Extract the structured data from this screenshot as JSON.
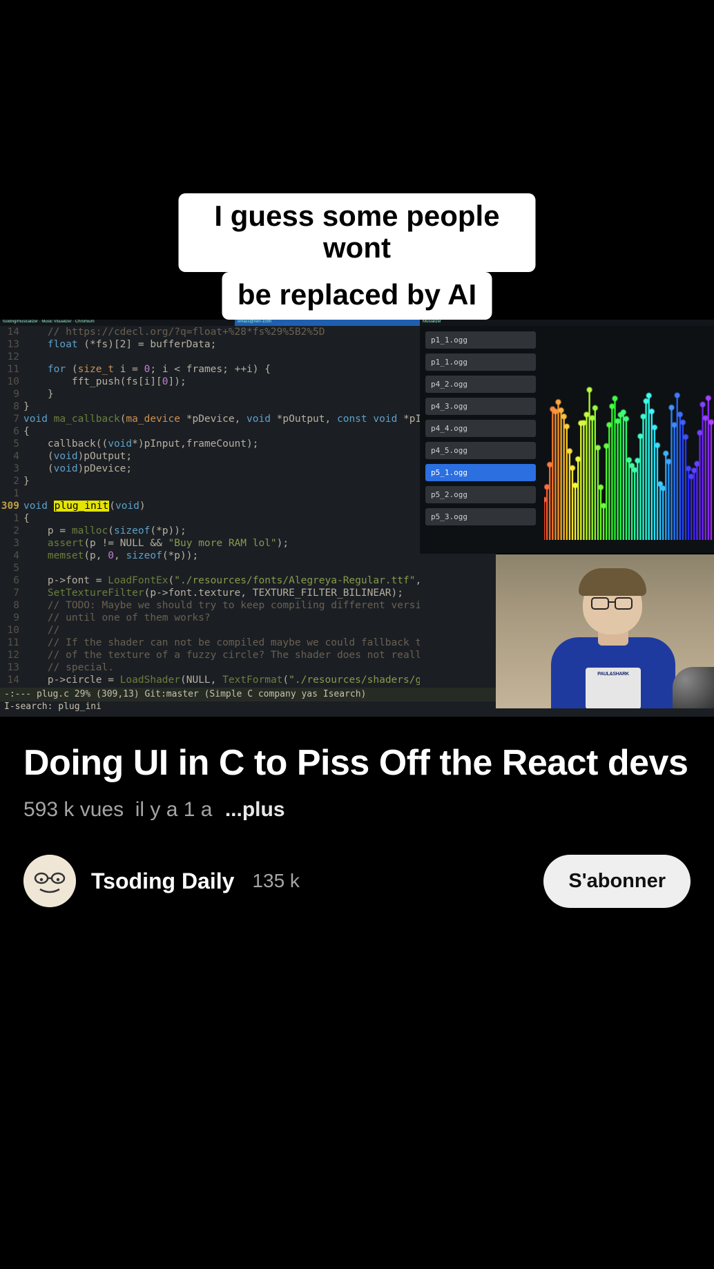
{
  "caption": {
    "l1": "I guess some people wont",
    "l2": "be replaced by AI"
  },
  "tabs": {
    "a": "tsoding/musicalizer · Music Visualizer · Chromium",
    "b": "emacs@rein-1590",
    "c": "Musializer"
  },
  "code": [
    {
      "n": "14",
      "t": "    // https://cdecl.org/?q=float+%28*fs%29%5B2%5D",
      "cls": "cm"
    },
    {
      "n": "13",
      "t": "    float (*fs)[2] = bufferData;",
      "mk": "kw:float"
    },
    {
      "n": "12",
      "t": ""
    },
    {
      "n": "11",
      "t": "    for (size_t i = 0; i < frames; ++i) {",
      "mk": "kw:for;ty:size_t;num:0"
    },
    {
      "n": "10",
      "t": "        fft_push(fs[i][0]);",
      "mk": "num:0"
    },
    {
      "n": "9",
      "t": "    }"
    },
    {
      "n": "8",
      "t": "}"
    },
    {
      "n": "7",
      "t": "void ma_callback(ma_device *pDevice, void *pOutput, const void *pInput,ma_u",
      "mk": "kw:void;kw:const;fn:ma_callback;ty:ma_device"
    },
    {
      "n": "6",
      "t": "{"
    },
    {
      "n": "5",
      "t": "    callback((void*)pInput,frameCount);",
      "mk": "kw:void"
    },
    {
      "n": "4",
      "t": "    (void)pOutput;",
      "mk": "kw:void"
    },
    {
      "n": "3",
      "t": "    (void)pDevice;",
      "mk": "kw:void"
    },
    {
      "n": "2",
      "t": "}"
    },
    {
      "n": "1",
      "t": ""
    },
    {
      "n": "309",
      "t": "void §plug_init§(void)",
      "big": true,
      "mk": "kw:void"
    },
    {
      "n": "1",
      "t": "{"
    },
    {
      "n": "2",
      "t": "    p = malloc(sizeof(*p));",
      "mk": "fn:malloc;kw:sizeof"
    },
    {
      "n": "3",
      "t": "    assert(p != NULL && \"Buy more RAM lol\");",
      "mk": "fn:assert;str:\"Buy more RAM lol\""
    },
    {
      "n": "4",
      "t": "    memset(p, 0, sizeof(*p));",
      "mk": "fn:memset;num:0;kw:sizeof"
    },
    {
      "n": "5",
      "t": ""
    },
    {
      "n": "6",
      "t": "    p->font = LoadFontEx(\"./resources/fonts/Alegreya-Regular.ttf\", FONT_SIZ",
      "mk": "fn:LoadFontEx;str:\"./resources/fonts/Alegreya-Regular.ttf\""
    },
    {
      "n": "7",
      "t": "    SetTextureFilter(p->font.texture, TEXTURE_FILTER_BILINEAR);",
      "mk": "fn:SetTextureFilter"
    },
    {
      "n": "8",
      "t": "    // TODO: Maybe we should try to keep compiling different versions of shaders",
      "cls": "cm"
    },
    {
      "n": "9",
      "t": "    // until one of them works?",
      "cls": "cm"
    },
    {
      "n": "10",
      "t": "    //",
      "cls": "cm"
    },
    {
      "n": "11",
      "t": "    // If the shader can not be compiled maybe we could fallback to software rendering",
      "cls": "cm"
    },
    {
      "n": "12",
      "t": "    // of the texture of a fuzzy circle? The shader does not really do anything particular",
      "cls": "cm"
    },
    {
      "n": "13",
      "t": "    // special.",
      "cls": "cm"
    },
    {
      "n": "14",
      "t": "    p->circle = LoadShader(NULL, TextFormat(\"./resources/shaders/glsl%d/circle.fs\", GLSL_V",
      "mk": "fn:LoadShader;fn:TextFormat;str:\"./resources/shaders/glsl%d/circle.fs\""
    }
  ],
  "status": "-:---  plug.c        29% (309,13)  Git:master  (Simple C company yas Isearch)",
  "minibuf": "I-search: plug_ini",
  "files": [
    "p1_1.ogg",
    "p1_1.ogg",
    "p4_2.ogg",
    "p4_3.ogg",
    "p4_4.ogg",
    "p4_5.ogg",
    "p5_1.ogg",
    "p5_2.ogg",
    "p5_3.ogg"
  ],
  "selected_file_index": 6,
  "shirt_logo": "PAUL&SHARK",
  "video_title": "Doing UI in C to Piss Off the React devs",
  "views": "593 k vues",
  "age": "il y a 1 a",
  "more": "...plus",
  "channel": "Tsoding Daily",
  "subscribers": "135 k",
  "subscribe": "S'abonner"
}
